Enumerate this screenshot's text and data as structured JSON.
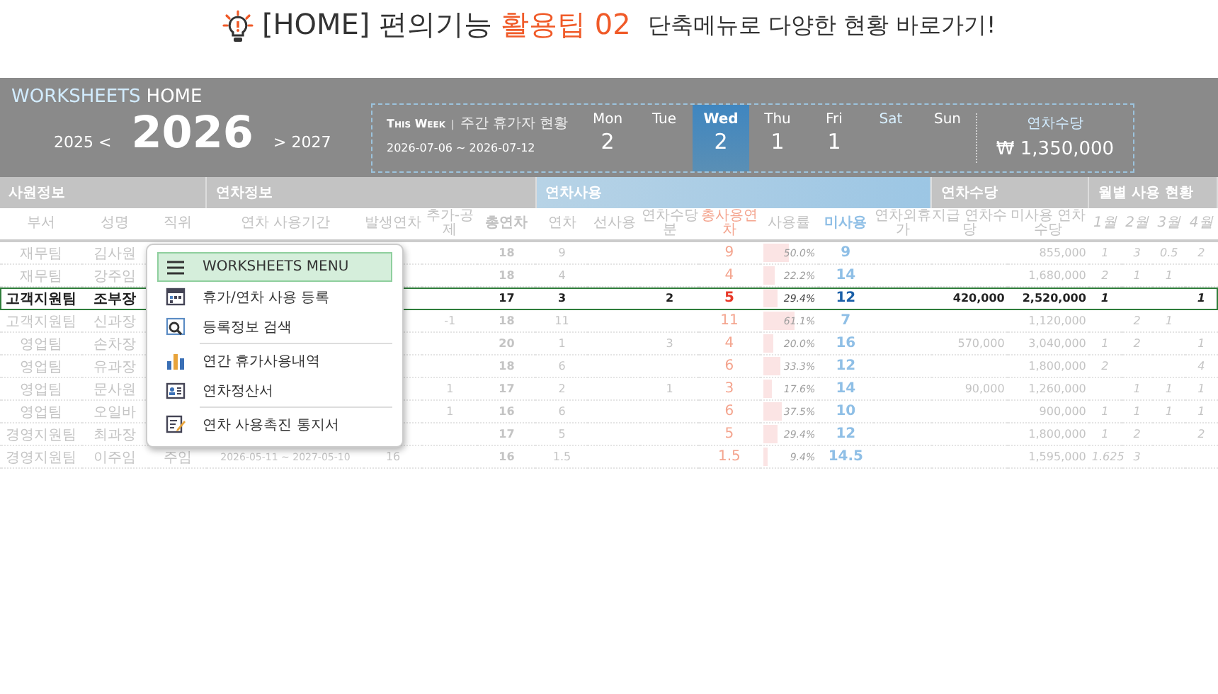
{
  "headline": {
    "prefix": "[HOME] 편의기능",
    "highlight": "활용팁 02",
    "subtitle": "단축메뉴로 다양한 현황 바로가기!"
  },
  "app": {
    "brand": "WORKSHEETS",
    "brand_page": "HOME",
    "prev_year": "2025 <",
    "year": "2026",
    "next_year": "> 2027",
    "week": {
      "label": "This Week",
      "separator": "|",
      "caption": "주간 휴가자 현황",
      "range": "2026-07-06 ~ 2026-07-12"
    },
    "days": [
      {
        "name": "Mon",
        "count": "2",
        "selected": false,
        "kind": "weekday"
      },
      {
        "name": "Tue",
        "selected": false,
        "kind": "weekday"
      },
      {
        "name": "Wed",
        "count": "2",
        "selected": true,
        "kind": "weekday"
      },
      {
        "name": "Thu",
        "count": "1",
        "selected": false,
        "kind": "weekday"
      },
      {
        "name": "Fri",
        "count": "1",
        "selected": false,
        "kind": "weekday"
      },
      {
        "name": "Sat",
        "selected": false,
        "kind": "saturday"
      },
      {
        "name": "Sun",
        "selected": false,
        "kind": "weekday"
      }
    ],
    "allowance": {
      "label": "연차수당",
      "amount": "₩ 1,350,000"
    }
  },
  "table": {
    "groups": [
      {
        "label": "사원정보",
        "kind": "plain"
      },
      {
        "label": "연차정보",
        "kind": "plain"
      },
      {
        "label": "연차사용",
        "kind": "accent"
      },
      {
        "label": "연차수당",
        "kind": "plain"
      },
      {
        "label": "월별 사용 현황",
        "kind": "plain"
      }
    ],
    "columns": [
      {
        "label": "부서",
        "kind": "plain"
      },
      {
        "label": "성명",
        "kind": "plain"
      },
      {
        "label": "직위",
        "kind": "plain"
      },
      {
        "label": "연차 사용기간",
        "kind": "plain"
      },
      {
        "label": "발생연차",
        "kind": "plain"
      },
      {
        "label": "추가-공제",
        "kind": "plain"
      },
      {
        "label": "총연차",
        "kind": "total"
      },
      {
        "label": "연차",
        "kind": "plain"
      },
      {
        "label": "선사용",
        "kind": "plain"
      },
      {
        "label": "연차수당분",
        "kind": "plain"
      },
      {
        "label": "총사용연차",
        "kind": "used"
      },
      {
        "label": "사용률",
        "kind": "rate"
      },
      {
        "label": "미사용",
        "kind": "unused"
      },
      {
        "label": "연차외휴가",
        "kind": "plain"
      },
      {
        "label": "지급 연차수당",
        "kind": "money"
      },
      {
        "label": "미사용 연차수당",
        "kind": "money"
      },
      {
        "label": "1월",
        "kind": "month"
      },
      {
        "label": "2월",
        "kind": "month"
      },
      {
        "label": "3월",
        "kind": "month"
      },
      {
        "label": "4월",
        "kind": "month"
      }
    ],
    "rows": [
      {
        "selected": false,
        "cells": [
          "재무팀",
          "김사원",
          null,
          null,
          null,
          null,
          "18",
          "9",
          null,
          null,
          "9",
          {
            "text": "50.0%",
            "level": 0.5
          },
          "9",
          null,
          null,
          "855,000",
          "1",
          "3",
          "0.5",
          "2"
        ]
      },
      {
        "selected": false,
        "cells": [
          "재무팀",
          "강주임",
          null,
          null,
          null,
          null,
          "18",
          "4",
          null,
          null,
          "4",
          {
            "text": "22.2%",
            "level": 0.222
          },
          "14",
          null,
          null,
          "1,680,000",
          "2",
          "1",
          "1",
          null
        ]
      },
      {
        "selected": true,
        "cells": [
          "고객지원팀",
          "조부장",
          null,
          null,
          null,
          null,
          "17",
          "3",
          null,
          "2",
          "5",
          {
            "text": "29.4%",
            "level": 0.294
          },
          "12",
          null,
          "420,000",
          "2,520,000",
          "1",
          null,
          null,
          "1"
        ]
      },
      {
        "selected": false,
        "cells": [
          "고객지원팀",
          "신과장",
          null,
          null,
          null,
          "-1",
          "18",
          "11",
          null,
          null,
          "11",
          {
            "text": "61.1%",
            "level": 0.611
          },
          "7",
          null,
          null,
          "1,120,000",
          null,
          "2",
          "1",
          null
        ]
      },
      {
        "selected": false,
        "cells": [
          "영업팀",
          "손차장",
          null,
          null,
          null,
          null,
          "20",
          "1",
          null,
          "3",
          "4",
          {
            "text": "20.0%",
            "level": 0.2
          },
          "16",
          null,
          "570,000",
          "3,040,000",
          "1",
          "2",
          null,
          "1"
        ]
      },
      {
        "selected": false,
        "cells": [
          "영업팀",
          "유과장",
          null,
          null,
          null,
          null,
          "18",
          "6",
          null,
          null,
          "6",
          {
            "text": "33.3%",
            "level": 0.333
          },
          "12",
          null,
          null,
          "1,800,000",
          "2",
          null,
          null,
          "4"
        ]
      },
      {
        "selected": false,
        "cells": [
          "영업팀",
          "문사원",
          null,
          null,
          null,
          "1",
          "17",
          "2",
          null,
          "1",
          "3",
          {
            "text": "17.6%",
            "level": 0.176
          },
          "14",
          null,
          "90,000",
          "1,260,000",
          null,
          "1",
          "1",
          "1"
        ]
      },
      {
        "selected": false,
        "cells": [
          "영업팀",
          "오일바",
          null,
          null,
          null,
          "1",
          "16",
          "6",
          null,
          null,
          "6",
          {
            "text": "37.5%",
            "level": 0.375
          },
          "10",
          null,
          null,
          "900,000",
          "1",
          "1",
          "1",
          "1"
        ]
      },
      {
        "selected": false,
        "cells": [
          "경영지원팀",
          "최과장",
          null,
          null,
          null,
          null,
          "17",
          "5",
          null,
          null,
          "5",
          {
            "text": "29.4%",
            "level": 0.294
          },
          "12",
          null,
          null,
          "1,800,000",
          "1",
          "2",
          null,
          "2"
        ]
      },
      {
        "selected": false,
        "cells": [
          "경영지원팀",
          "이주임",
          "주임",
          "2026-05-11 ~ 2027-05-10",
          "16",
          null,
          "16",
          "1.5",
          null,
          null,
          "1.5",
          {
            "text": "9.4%",
            "level": 0.094
          },
          "14.5",
          null,
          null,
          "1,595,000",
          "1.625",
          "3",
          null,
          null
        ]
      }
    ]
  },
  "menu": {
    "items": [
      {
        "label": "WORKSHEETS MENU",
        "selected": true,
        "separator_before": false
      },
      {
        "label": "휴가/연차 사용 등록",
        "selected": false,
        "separator_before": false
      },
      {
        "label": "등록정보 검색",
        "selected": false,
        "separator_before": false
      },
      {
        "label": "연간 휴가사용내역",
        "selected": false,
        "separator_before": true
      },
      {
        "label": "연차정산서",
        "selected": false,
        "separator_before": false
      },
      {
        "label": "연차 사용촉진 통지서",
        "selected": false,
        "separator_before": true
      }
    ]
  }
}
